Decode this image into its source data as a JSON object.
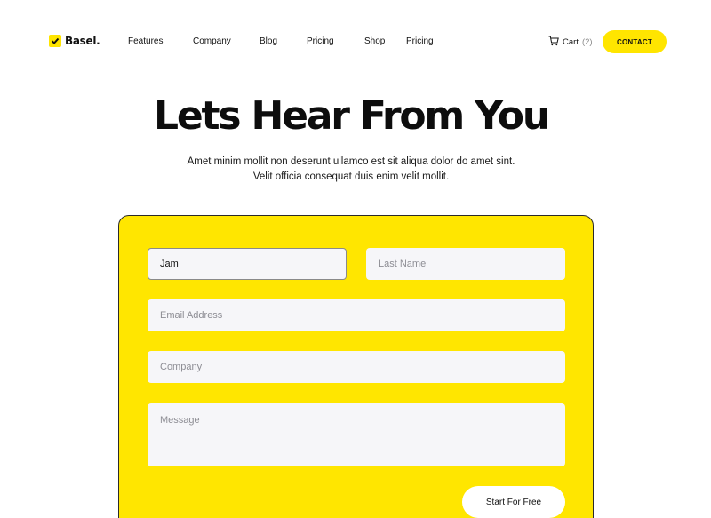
{
  "brand": {
    "name": "Basel.",
    "accent": "#FFE500"
  },
  "nav": {
    "links": [
      "Features",
      "Company",
      "Blog",
      "Pricing",
      "Shop",
      "Pricing"
    ],
    "cart_label": "Cart",
    "cart_count": "(2)",
    "contact_label": "CONTACT"
  },
  "hero": {
    "title": "Lets Hear From You",
    "subtitle_line1": "Amet minim mollit non deserunt ullamco est sit aliqua dolor do amet sint.",
    "subtitle_line2": "Velit officia consequat duis enim velit mollit."
  },
  "form": {
    "first_name_value": "Jam",
    "last_name_placeholder": "Last Name",
    "email_placeholder": "Email Address",
    "company_placeholder": "Company",
    "message_placeholder": "Message",
    "submit_label": "Start For Free",
    "card_color": "#FFE600"
  },
  "icons": {
    "logo": "checkmark-badge-icon",
    "cart": "cart-icon"
  }
}
